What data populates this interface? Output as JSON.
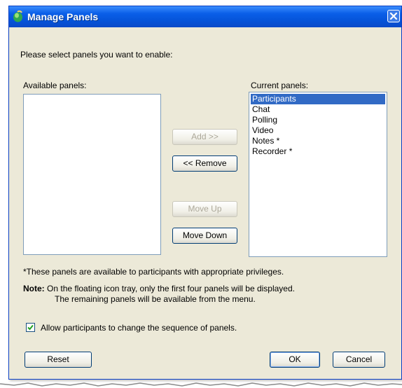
{
  "window": {
    "title": "Manage Panels",
    "close_glyph": "✕"
  },
  "dialog": {
    "prompt": "Please select panels you want to enable:",
    "available_label": "Available panels:",
    "current_label": "Current panels:",
    "available_items": [],
    "current_items": [
      {
        "label": "Participants",
        "selected": true
      },
      {
        "label": "Chat",
        "selected": false
      },
      {
        "label": "Polling",
        "selected": false
      },
      {
        "label": "Video",
        "selected": false
      },
      {
        "label": "Notes *",
        "selected": false
      },
      {
        "label": "Recorder *",
        "selected": false
      }
    ],
    "buttons": {
      "add": "Add >>",
      "remove": "<< Remove",
      "move_up": "Move Up",
      "move_down": "Move Down",
      "reset": "Reset",
      "ok": "OK",
      "cancel": "Cancel"
    },
    "privileges_note": "*These panels are available to participants with appropriate privileges.",
    "note_heading": "Note:",
    "note_line1": "On the floating icon tray, only the first four panels will be displayed.",
    "note_line2": "The remaining panels will be available from the menu.",
    "checkbox_label": "Allow participants to change the sequence of panels.",
    "checkbox_checked": true
  },
  "colors": {
    "titlebar": "#0a5ee8",
    "selection": "#316ac5",
    "dialog_bg": "#ece9d8"
  },
  "icons": {
    "app": "app-globe-icon",
    "close": "close-icon",
    "check": "checkmark-icon"
  }
}
